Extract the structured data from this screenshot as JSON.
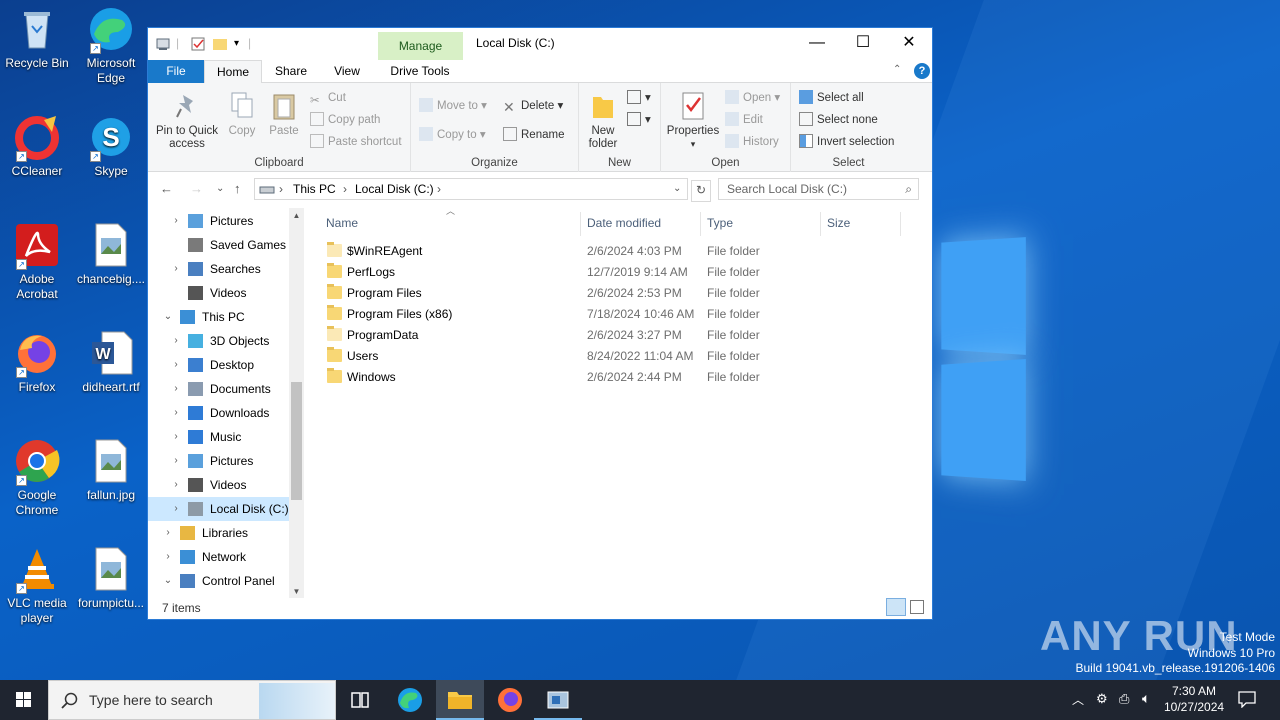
{
  "desktop": {
    "icons": [
      {
        "label": "Recycle Bin"
      },
      {
        "label": "Microsoft Edge"
      },
      {
        "label": "CCleaner"
      },
      {
        "label": "Skype"
      },
      {
        "label": "Adobe Acrobat"
      },
      {
        "label": "chancebig...."
      },
      {
        "label": "Firefox"
      },
      {
        "label": "didheart.rtf"
      },
      {
        "label": "Google Chrome"
      },
      {
        "label": "fallun.jpg"
      },
      {
        "label": "VLC media player"
      },
      {
        "label": "forumpictu..."
      }
    ],
    "watermark": "ANY RUN",
    "test_mode": [
      "Test Mode",
      "Windows 10 Pro",
      "Build 19041.vb_release.191206-1406"
    ]
  },
  "explorer": {
    "title": "Local Disk (C:)",
    "manage_tab": "Manage",
    "tabs": {
      "file": "File",
      "home": "Home",
      "share": "Share",
      "view": "View",
      "drive_tools": "Drive Tools"
    },
    "ribbon": {
      "clipboard": {
        "label": "Clipboard",
        "pin": "Pin to Quick access",
        "copy": "Copy",
        "paste": "Paste",
        "cut": "Cut",
        "copy_path": "Copy path",
        "paste_shortcut": "Paste shortcut"
      },
      "organize": {
        "label": "Organize",
        "move_to": "Move to",
        "delete": "Delete",
        "copy_to": "Copy to",
        "rename": "Rename"
      },
      "new": {
        "label": "New",
        "new_folder": "New folder"
      },
      "open": {
        "label": "Open",
        "properties": "Properties",
        "open": "Open",
        "edit": "Edit",
        "history": "History"
      },
      "select": {
        "label": "Select",
        "select_all": "Select all",
        "select_none": "Select none",
        "invert": "Invert selection"
      }
    },
    "address": {
      "crumbs": [
        "This PC",
        "Local Disk (C:)"
      ]
    },
    "search_placeholder": "Search Local Disk (C:)",
    "nav": [
      {
        "label": "Pictures",
        "indent": 1,
        "chev": "›"
      },
      {
        "label": "Saved Games",
        "indent": 1,
        "chev": ""
      },
      {
        "label": "Searches",
        "indent": 1,
        "chev": "›"
      },
      {
        "label": "Videos",
        "indent": 1,
        "chev": ""
      },
      {
        "label": "This PC",
        "indent": 0,
        "chev": "⌄"
      },
      {
        "label": "3D Objects",
        "indent": 1,
        "chev": "›"
      },
      {
        "label": "Desktop",
        "indent": 1,
        "chev": "›"
      },
      {
        "label": "Documents",
        "indent": 1,
        "chev": "›"
      },
      {
        "label": "Downloads",
        "indent": 1,
        "chev": "›"
      },
      {
        "label": "Music",
        "indent": 1,
        "chev": "›"
      },
      {
        "label": "Pictures",
        "indent": 1,
        "chev": "›"
      },
      {
        "label": "Videos",
        "indent": 1,
        "chev": "›"
      },
      {
        "label": "Local Disk (C:)",
        "indent": 1,
        "chev": "›",
        "selected": true
      },
      {
        "label": "Libraries",
        "indent": 0,
        "chev": "›"
      },
      {
        "label": "Network",
        "indent": 0,
        "chev": "›"
      },
      {
        "label": "Control Panel",
        "indent": 0,
        "chev": "⌄"
      }
    ],
    "columns": {
      "name": "Name",
      "date": "Date modified",
      "type": "Type",
      "size": "Size"
    },
    "files": [
      {
        "name": "$WinREAgent",
        "date": "2/6/2024 4:03 PM",
        "type": "File folder"
      },
      {
        "name": "PerfLogs",
        "date": "12/7/2019 9:14 AM",
        "type": "File folder"
      },
      {
        "name": "Program Files",
        "date": "2/6/2024 2:53 PM",
        "type": "File folder"
      },
      {
        "name": "Program Files (x86)",
        "date": "7/18/2024 10:46 AM",
        "type": "File folder"
      },
      {
        "name": "ProgramData",
        "date": "2/6/2024 3:27 PM",
        "type": "File folder"
      },
      {
        "name": "Users",
        "date": "8/24/2022 11:04 AM",
        "type": "File folder"
      },
      {
        "name": "Windows",
        "date": "2/6/2024 2:44 PM",
        "type": "File folder"
      }
    ],
    "status": "7 items"
  },
  "taskbar": {
    "search_placeholder": "Type here to search",
    "time": "7:30 AM",
    "date": "10/27/2024"
  }
}
